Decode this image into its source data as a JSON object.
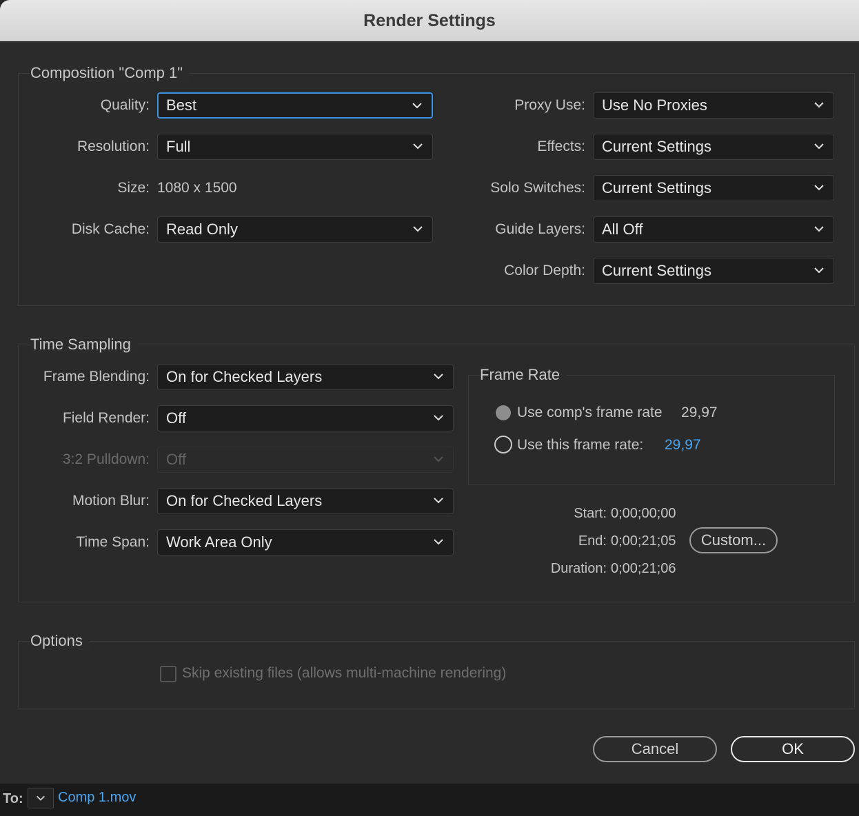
{
  "window": {
    "title": "Render Settings"
  },
  "composition": {
    "title": "Composition \"Comp 1\"",
    "quality": {
      "label": "Quality:",
      "value": "Best"
    },
    "resolution": {
      "label": "Resolution:",
      "value": "Full"
    },
    "size": {
      "label": "Size:",
      "value": "1080 x 1500"
    },
    "disk_cache": {
      "label": "Disk Cache:",
      "value": "Read Only"
    },
    "proxy_use": {
      "label": "Proxy Use:",
      "value": "Use No Proxies"
    },
    "effects": {
      "label": "Effects:",
      "value": "Current Settings"
    },
    "solo_switches": {
      "label": "Solo Switches:",
      "value": "Current Settings"
    },
    "guide_layers": {
      "label": "Guide Layers:",
      "value": "All Off"
    },
    "color_depth": {
      "label": "Color Depth:",
      "value": "Current Settings"
    }
  },
  "time_sampling": {
    "title": "Time Sampling",
    "frame_blending": {
      "label": "Frame Blending:",
      "value": "On for Checked Layers"
    },
    "field_render": {
      "label": "Field Render:",
      "value": "Off"
    },
    "pulldown": {
      "label": "3:2 Pulldown:",
      "value": "Off"
    },
    "motion_blur": {
      "label": "Motion Blur:",
      "value": "On for Checked Layers"
    },
    "time_span": {
      "label": "Time Span:",
      "value": "Work Area Only"
    },
    "frame_rate": {
      "title": "Frame Rate",
      "use_comp": {
        "label": "Use comp's frame rate",
        "value": "29,97",
        "selected": true
      },
      "use_this": {
        "label": "Use this frame rate:",
        "value": "29,97",
        "selected": false
      }
    },
    "start": {
      "label": "Start:",
      "value": "0;00;00;00"
    },
    "end": {
      "label": "End:",
      "value": "0;00;21;05"
    },
    "duration": {
      "label": "Duration:",
      "value": "0;00;21;06"
    },
    "custom_button": "Custom..."
  },
  "options": {
    "title": "Options",
    "skip_existing": {
      "label": "Skip existing files (allows multi-machine rendering)",
      "checked": false
    }
  },
  "buttons": {
    "cancel": "Cancel",
    "ok": "OK"
  },
  "bottom_bar": {
    "to_label": "To:",
    "file": "Comp 1.mov"
  },
  "colors": {
    "accent": "#3d8fe0",
    "link": "#4aa6f2",
    "background": "#2b2b2b"
  }
}
